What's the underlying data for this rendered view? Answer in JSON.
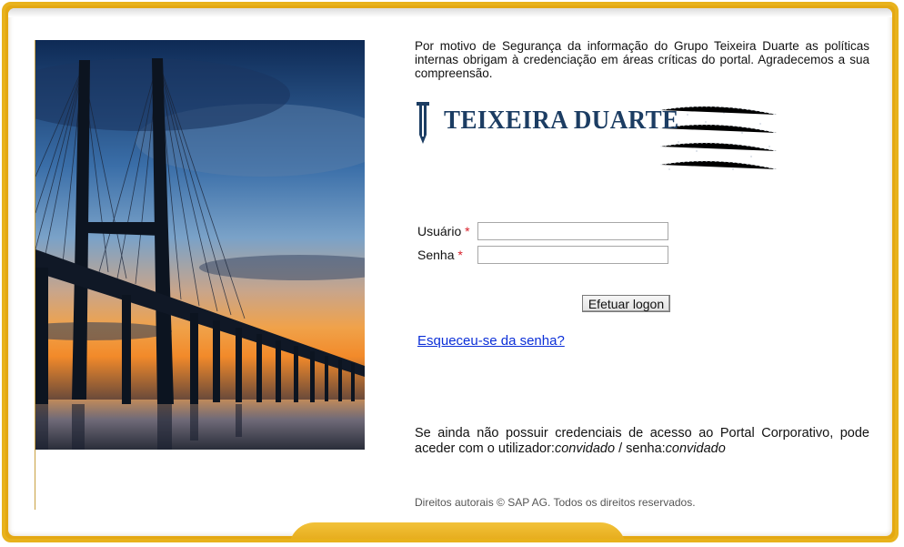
{
  "colors": {
    "frame_gold": "#e8b21c",
    "link_blue": "#0b2fd8",
    "required_red": "#d8202a",
    "logo_navy": "#1c3d63"
  },
  "notice": "Por motivo de Segurança da informação do Grupo Teixeira Duarte as políticas internas obrigam à credenciação em áreas críticas do portal. Agradecemos a sua compreensão.",
  "logo": {
    "text": "TEIXEIRA DUARTE",
    "icon": "teixeira-duarte-emblem-icon"
  },
  "photo": {
    "icon": "bridge-sunset-photo"
  },
  "form": {
    "user_label": "Usuário",
    "password_label": "Senha",
    "required_mark": "*",
    "user_value": "",
    "password_value": "",
    "submit_label": "Efetuar logon",
    "forgot_link": "Esqueceu-se da senha?"
  },
  "guest": {
    "text_before": "Se ainda não possuir credenciais de acesso ao Portal Corporativo, pode aceder com o utilizador:",
    "user": "convidado",
    "separator": " / senha:",
    "password": "convidado"
  },
  "footer": {
    "copyright": "Direitos autorais © SAP AG. Todos os direitos reservados."
  }
}
